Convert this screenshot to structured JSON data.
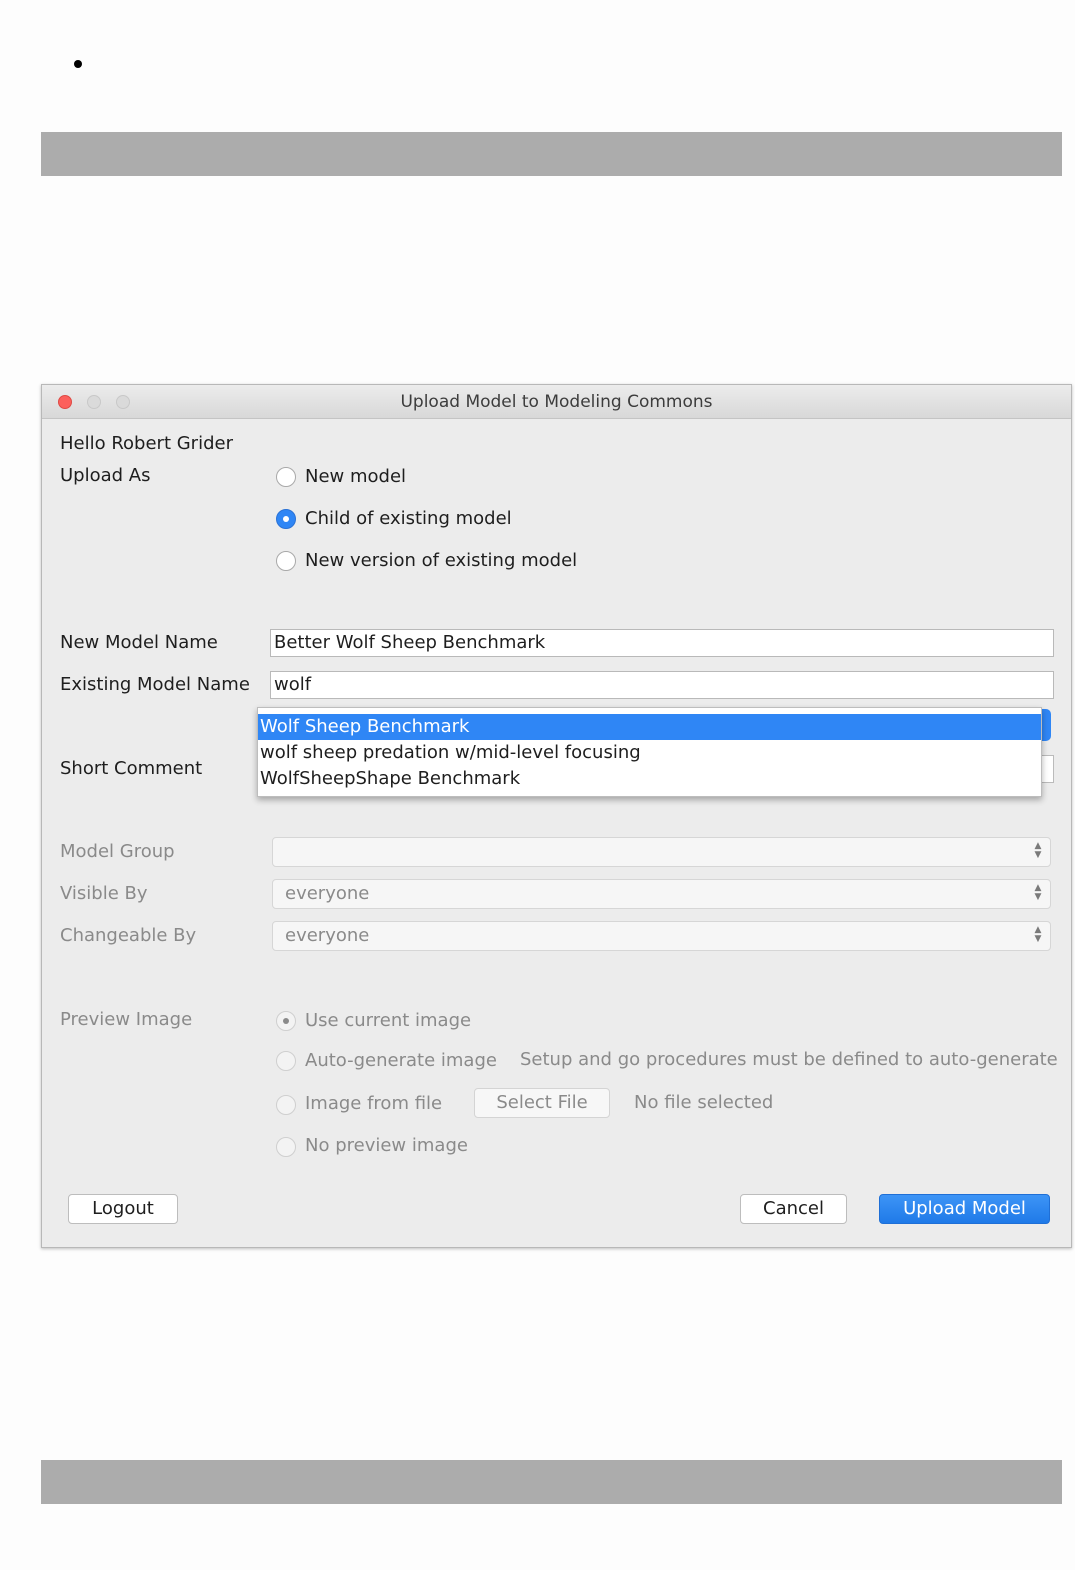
{
  "window": {
    "title": "Upload Model to Modeling Commons"
  },
  "greeting": "Hello Robert Grider",
  "upload_as": {
    "label": "Upload As",
    "options": [
      "New model",
      "Child of existing model",
      "New version of existing model"
    ],
    "selected": "Child of existing model"
  },
  "new_model_name": {
    "label": "New Model Name",
    "value": "Better Wolf Sheep Benchmark"
  },
  "existing_model_name": {
    "label": "Existing Model Name",
    "value": "wolf",
    "suggestions": [
      "Wolf Sheep Benchmark",
      "wolf sheep predation w/mid-level focusing",
      "WolfSheepShape Benchmark"
    ],
    "highlighted": "Wolf Sheep Benchmark"
  },
  "short_comment": {
    "label": "Short Comment"
  },
  "model_group": {
    "label": "Model Group",
    "value": ""
  },
  "visible_by": {
    "label": "Visible By",
    "value": "everyone"
  },
  "changeable_by": {
    "label": "Changeable By",
    "value": "everyone"
  },
  "preview_image": {
    "label": "Preview Image",
    "options": [
      "Use current image",
      "Auto-generate image",
      "Image from file",
      "No preview image"
    ],
    "selected": "Use current image",
    "auto_generate_note": "Setup and go procedures must be defined to auto-generate",
    "select_file_label": "Select File",
    "file_status": "No file selected"
  },
  "buttons": {
    "logout": "Logout",
    "cancel": "Cancel",
    "upload": "Upload Model"
  },
  "colors": {
    "accent": "#2f86f5",
    "close_light": "#fc605c",
    "page_bar": "#acacac"
  }
}
